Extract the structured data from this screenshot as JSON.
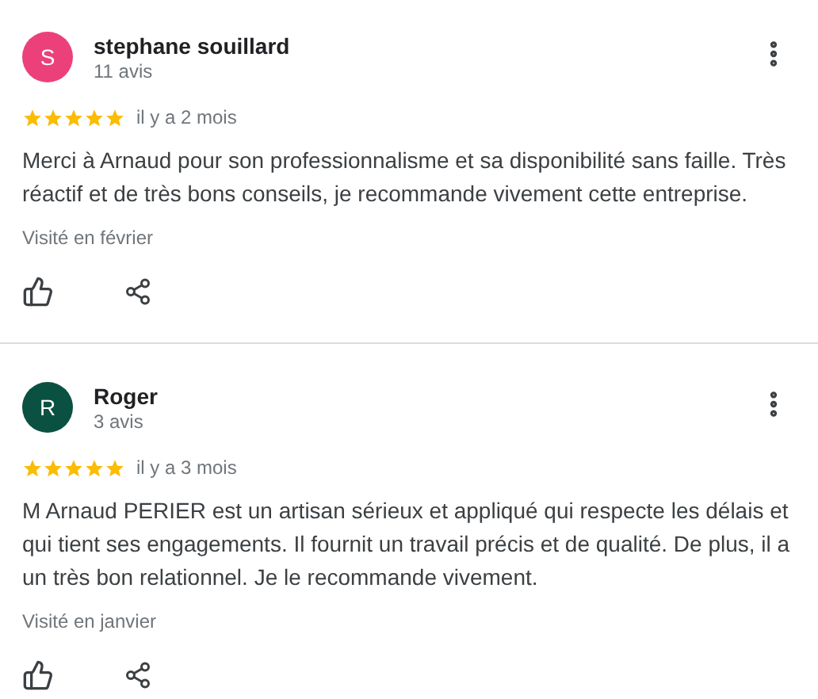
{
  "reviews": [
    {
      "avatar_letter": "S",
      "color": "#ec407a",
      "name": "stephane souillard",
      "review_count": "11 avis",
      "stars": 5,
      "time": "il y a 2 mois",
      "text": "Merci à Arnaud pour son professionnalisme et sa disponibilité sans faille. Très réactif et de très bons conseils, je recommande vivement cette entreprise.",
      "visited": "Visité en février"
    },
    {
      "avatar_letter": "R",
      "color": "#0b5142",
      "name": "Roger",
      "review_count": "3 avis",
      "stars": 5,
      "time": "il y a 3 mois",
      "text": "M Arnaud PERIER est un artisan sérieux et appliqué qui respecte les délais et qui tient ses engagements. Il fournit un travail précis et de qualité. De plus, il a un très bon relationnel. Je le recommande vivement.",
      "visited": "Visité en janvier"
    }
  ]
}
